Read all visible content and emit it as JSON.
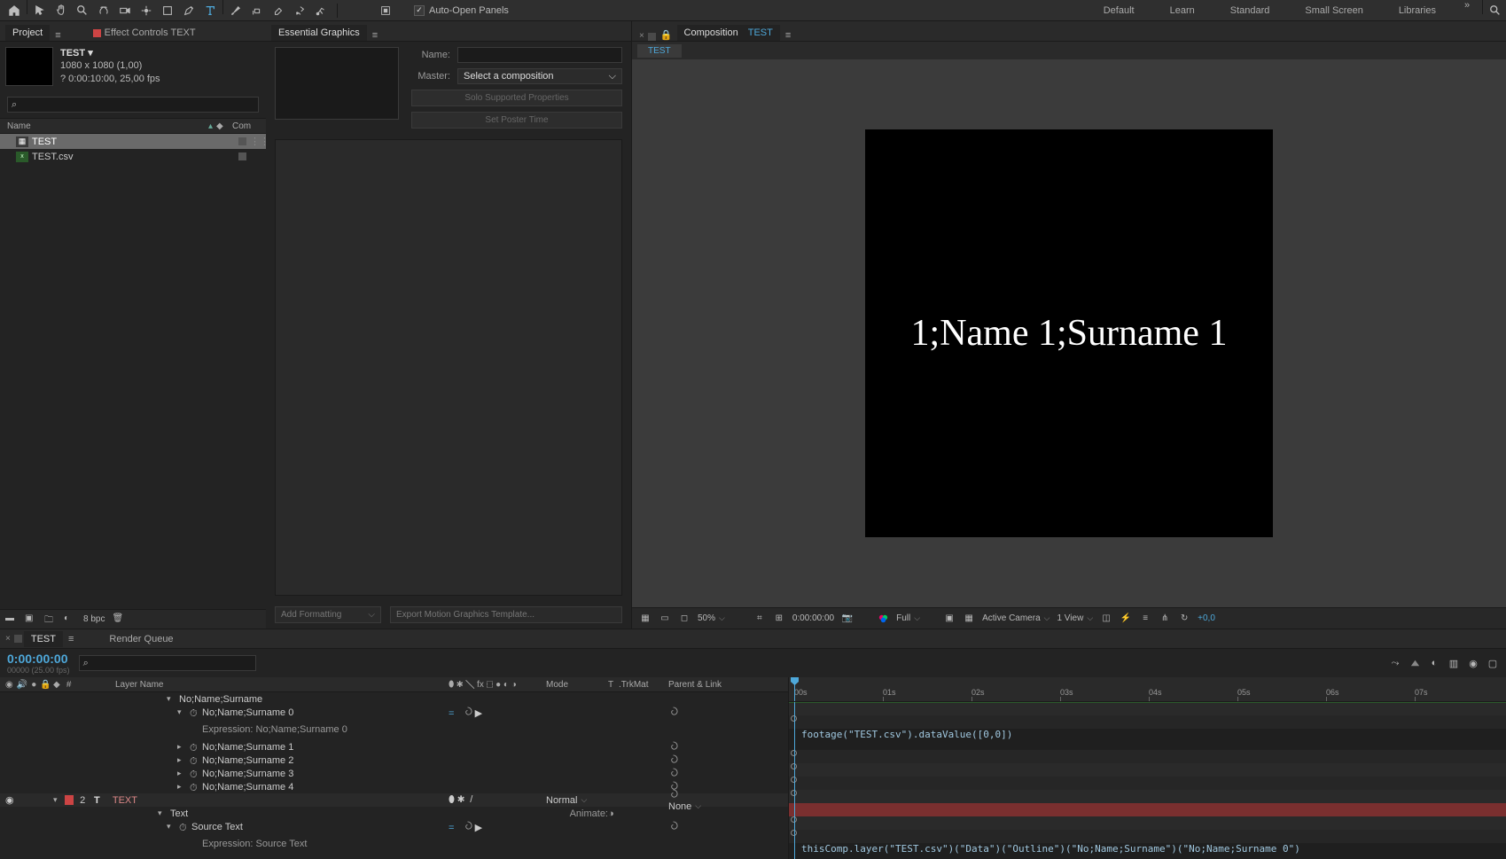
{
  "toolbar": {
    "auto_open": "Auto-Open Panels",
    "workspaces": [
      "Default",
      "Learn",
      "Standard",
      "Small Screen",
      "Libraries"
    ]
  },
  "project": {
    "tab": "Project",
    "fx_tab": "Effect Controls TEXT",
    "item_name": "TEST",
    "dims": "1080 x 1080 (1,00)",
    "dur": "? 0:00:10:00, 25,00 fps",
    "col_name": "Name",
    "col_com": "Com",
    "rows": [
      {
        "name": "TEST",
        "type": "comp",
        "selected": true
      },
      {
        "name": "TEST.csv",
        "type": "csv",
        "selected": false
      }
    ],
    "bpc": "8 bpc"
  },
  "eg": {
    "title": "Essential Graphics",
    "name_label": "Name:",
    "master_label": "Master:",
    "master_value": "Select a composition",
    "solo": "Solo Supported Properties",
    "poster": "Set Poster Time",
    "add": "Add Formatting",
    "export": "Export Motion Graphics Template..."
  },
  "comp": {
    "prefix": "Composition",
    "name": "TEST",
    "subtab": "TEST",
    "canvas_text": "1;Name 1;Surname 1",
    "zoom": "50%",
    "time": "0:00:00:00",
    "res": "Full",
    "camera": "Active Camera",
    "view": "1 View",
    "offset": "+0,0"
  },
  "timeline": {
    "tab": "TEST",
    "rq": "Render Queue",
    "time": "0:00:00:00",
    "sub": "00000 (25.00 fps)",
    "cols": {
      "name": "Layer Name",
      "mode": "Mode",
      "t": "T",
      "trk": ".TrkMat",
      "par": "Parent & Link",
      "num": "#"
    },
    "rows": [
      {
        "t": "head",
        "text": "No;Name;Surname"
      },
      {
        "t": "prop",
        "text": "No;Name;Surname 0",
        "open": true
      },
      {
        "t": "exp",
        "text": "Expression: No;Name;Surname 0",
        "code": "footage(\"TEST.csv\").dataValue([0,0])"
      },
      {
        "t": "prop",
        "text": "No;Name;Surname 1"
      },
      {
        "t": "prop",
        "text": "No;Name;Surname 2"
      },
      {
        "t": "prop",
        "text": "No;Name;Surname 3"
      },
      {
        "t": "prop",
        "text": "No;Name;Surname 4"
      },
      {
        "t": "layer",
        "num": "2",
        "text": "TEXT",
        "mode": "Normal",
        "par": "None"
      },
      {
        "t": "group",
        "text": "Text",
        "animate": "Animate:"
      },
      {
        "t": "prop2",
        "text": "Source Text",
        "open": true
      },
      {
        "t": "exp",
        "text": "Expression: Source Text",
        "code": "thisComp.layer(\"TEST.csv\")(\"Data\")(\"Outline\")(\"No;Name;Surname\")(\"No;Name;Surname 0\")"
      }
    ],
    "ruler": [
      "00s",
      "01s",
      "02s",
      "03s",
      "04s",
      "05s",
      "06s",
      "07s"
    ],
    "switches": "⬮ ✱ ╲ fx ⬚ ● ◐ ◑"
  }
}
